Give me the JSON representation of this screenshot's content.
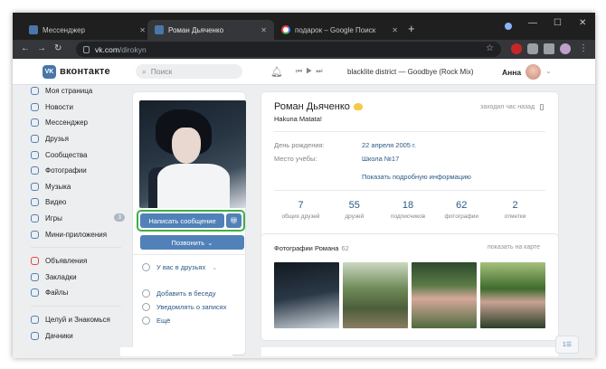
{
  "browser": {
    "tabs": [
      {
        "title": "Мессенджер",
        "active": false
      },
      {
        "title": "Роман Дьяченко",
        "active": true
      },
      {
        "title": "подарок – Google Поиск",
        "active": false
      }
    ],
    "url_host": "vk.com",
    "url_path": "/dirokyn"
  },
  "vk_header": {
    "logo_text": "вконтакте",
    "search_placeholder": "Поиск",
    "now_playing": "blacklite district — Goodbye (Rock Mix)",
    "user_name": "Анна"
  },
  "left_menu": {
    "items": [
      {
        "label": "Моя страница"
      },
      {
        "label": "Новости"
      },
      {
        "label": "Мессенджер"
      },
      {
        "label": "Друзья"
      },
      {
        "label": "Сообщества"
      },
      {
        "label": "Фотографии"
      },
      {
        "label": "Музыка"
      },
      {
        "label": "Видео"
      },
      {
        "label": "Игры",
        "badge": "3"
      },
      {
        "label": "Мини-приложения"
      }
    ],
    "items2": [
      {
        "label": "Объявления"
      },
      {
        "label": "Закладки"
      },
      {
        "label": "Файлы"
      }
    ],
    "items3": [
      {
        "label": "Целуй и Знакомься"
      },
      {
        "label": "Дачники"
      }
    ]
  },
  "profile_actions": {
    "write_message": "Написать сообщение",
    "call": "Позвонить",
    "in_friends": "У вас в друзьях",
    "add_to_chat": "Добавить в беседу",
    "notify_posts": "Уведомлять о записях",
    "more": "Ещё"
  },
  "profile": {
    "name": "Роман Дьяченко",
    "status": "Hakuna Matata!",
    "last_seen": "заходил час назад",
    "birthday_label": "День рождения:",
    "birthday_value": "22 апреля 2005 г.",
    "school_label": "Место учёбы:",
    "school_value": "Школа №17",
    "more_info": "Показать подробную информацию"
  },
  "counters": [
    {
      "num": "7",
      "label": "общих друзей"
    },
    {
      "num": "55",
      "label": "друзей"
    },
    {
      "num": "18",
      "label": "подписчиков"
    },
    {
      "num": "62",
      "label": "фотографии"
    },
    {
      "num": "2",
      "label": "отметки"
    }
  ],
  "photos": {
    "title": "Фотографии Романа",
    "count": "62",
    "show_on_map": "показать на карте"
  },
  "chat_widget": {
    "count": "1"
  },
  "colors": {
    "vk_blue": "#5181b8",
    "link_blue": "#2a5885",
    "highlight_green": "#3cb043",
    "page_bg": "#edeef0"
  }
}
